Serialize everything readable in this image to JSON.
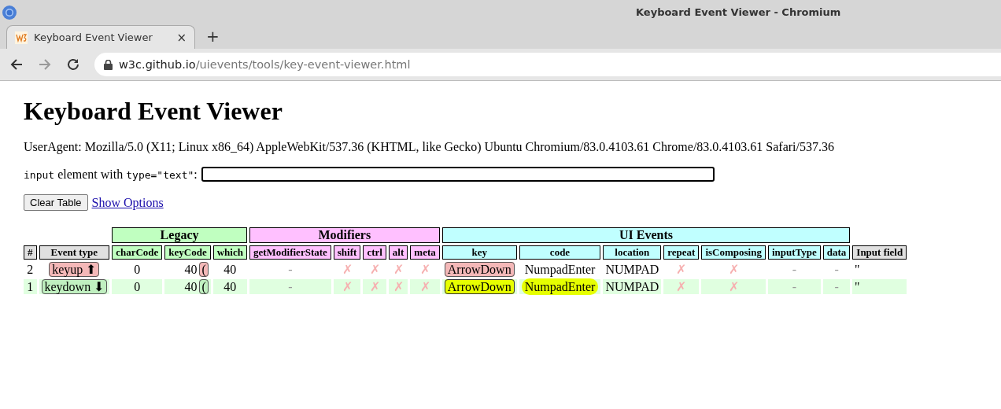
{
  "window": {
    "title": "Keyboard Event Viewer - Chromium"
  },
  "tabs": [
    {
      "label": "Keyboard Event Viewer",
      "close": "×",
      "selected": true
    }
  ],
  "new_tab": "+",
  "address": {
    "host": "w3c.github.io",
    "path": "/uievents/tools/key-event-viewer.html"
  },
  "page": {
    "heading": "Keyboard Event Viewer",
    "user_agent": "UserAgent: Mozilla/5.0 (X11; Linux x86_64) AppleWebKit/537.36 (KHTML, like Gecko) Ubuntu Chromium/83.0.4103.61 Chrome/83.0.4103.61 Safari/537.36",
    "input_label": [
      {
        "kind": "code",
        "text": "input"
      },
      {
        "kind": "text",
        "text": " element with "
      },
      {
        "kind": "code",
        "text": "type=\"text\""
      },
      {
        "kind": "text",
        "text": ":"
      }
    ],
    "clear_button": "Clear Table",
    "options_link": "Show Options"
  },
  "table": {
    "groups": [
      {
        "label": "Legacy",
        "kind": "legacy"
      },
      {
        "label": "Modifiers",
        "kind": "modifiers"
      },
      {
        "label": "UI Events",
        "kind": "ui"
      }
    ],
    "columns": [
      {
        "label": "#",
        "kind": "plain"
      },
      {
        "label": "Event type",
        "kind": "plain"
      },
      {
        "label": "charCode",
        "kind": "legacy"
      },
      {
        "label": "keyCode",
        "kind": "legacy"
      },
      {
        "label": "which",
        "kind": "legacy"
      },
      {
        "label": "getModifierState",
        "kind": "modifiers"
      },
      {
        "label": "shift",
        "kind": "modifiers"
      },
      {
        "label": "ctrl",
        "kind": "modifiers"
      },
      {
        "label": "alt",
        "kind": "modifiers"
      },
      {
        "label": "meta",
        "kind": "modifiers"
      },
      {
        "label": "key",
        "kind": "ui"
      },
      {
        "label": "code",
        "kind": "ui"
      },
      {
        "label": "location",
        "kind": "ui"
      },
      {
        "label": "repeat",
        "kind": "ui"
      },
      {
        "label": "isComposing",
        "kind": "ui"
      },
      {
        "label": "inputType",
        "kind": "ui"
      },
      {
        "label": "data",
        "kind": "ui"
      },
      {
        "label": "Input field",
        "kind": "plain"
      }
    ],
    "rows": [
      {
        "kind": "keyup",
        "cells": [
          {
            "kind": "text",
            "text": "2"
          },
          {
            "kind": "badge",
            "text": "keyup ⬆"
          },
          {
            "kind": "text",
            "text": "0"
          },
          {
            "kind": "keycode",
            "text": "40",
            "char": "("
          },
          {
            "kind": "text",
            "text": "40"
          },
          {
            "kind": "dash",
            "text": "-"
          },
          {
            "kind": "flag",
            "text": "✗"
          },
          {
            "kind": "flag",
            "text": "✗"
          },
          {
            "kind": "flag",
            "text": "✗"
          },
          {
            "kind": "flag",
            "text": "✗"
          },
          {
            "kind": "badge",
            "text": "ArrowDown",
            "highlighted": false
          },
          {
            "kind": "text",
            "text": "NumpadEnter",
            "highlighted": false
          },
          {
            "kind": "text",
            "text": "NUMPAD"
          },
          {
            "kind": "flag",
            "text": "✗"
          },
          {
            "kind": "flag",
            "text": "✗"
          },
          {
            "kind": "dash",
            "text": "-"
          },
          {
            "kind": "dash",
            "text": "-"
          },
          {
            "kind": "left",
            "text": "''"
          }
        ]
      },
      {
        "kind": "keydown",
        "cells": [
          {
            "kind": "text",
            "text": "1"
          },
          {
            "kind": "badge",
            "text": "keydown ⬇"
          },
          {
            "kind": "text",
            "text": "0"
          },
          {
            "kind": "keycode",
            "text": "40",
            "char": "("
          },
          {
            "kind": "text",
            "text": "40"
          },
          {
            "kind": "dash",
            "text": "-"
          },
          {
            "kind": "flag",
            "text": "✗"
          },
          {
            "kind": "flag",
            "text": "✗"
          },
          {
            "kind": "flag",
            "text": "✗"
          },
          {
            "kind": "flag",
            "text": "✗"
          },
          {
            "kind": "badge",
            "text": "ArrowDown",
            "highlighted": true
          },
          {
            "kind": "text",
            "text": "NumpadEnter",
            "highlighted": true
          },
          {
            "kind": "text",
            "text": "NUMPAD"
          },
          {
            "kind": "flag",
            "text": "✗"
          },
          {
            "kind": "flag",
            "text": "✗"
          },
          {
            "kind": "dash",
            "text": "-"
          },
          {
            "kind": "dash",
            "text": "-"
          },
          {
            "kind": "left",
            "text": "''"
          }
        ]
      }
    ]
  }
}
